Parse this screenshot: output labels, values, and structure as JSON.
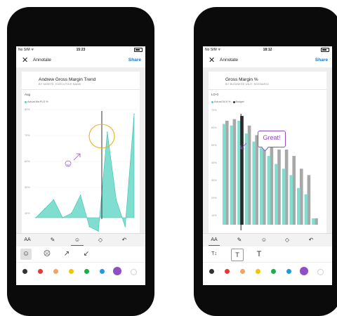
{
  "left_phone": {
    "status": {
      "carrier": "No SIM ᯤ",
      "time": "15:23"
    },
    "header": {
      "title": "Annotate",
      "share_label": "Share"
    },
    "card": {
      "title": "Andrew Gross Margin Trend",
      "subtitle": "BY MONTH, EXECUTIVE NAME",
      "chart_header": "Aug",
      "legend_series": "Actual Ma PLS %",
      "y_ticks": [
        "80%",
        "70%",
        "60%",
        "50%",
        "40%"
      ]
    },
    "toolbar": {
      "text_size": "AA",
      "pen": "✎",
      "stamp": "☺",
      "eraser": "◇",
      "undo": "↶"
    },
    "stamps": {
      "smiley": "☺",
      "neutral": "☹",
      "arrow_up": "↗",
      "arrow_down": "↙"
    },
    "colors": [
      "#333333",
      "#e53935",
      "#f4a261",
      "#f5c400",
      "#1aad4b",
      "#1e9be0",
      "#8f4fc4",
      "#ffffff"
    ]
  },
  "right_phone": {
    "status": {
      "carrier": "No SIM ᯤ",
      "time": "18:12"
    },
    "header": {
      "title": "Annotate",
      "share_label": "Share"
    },
    "card": {
      "title": "Gross Margin %",
      "subtitle": "BY BUSINESS UNIT, SCENARIO",
      "chart_header": "LO-0",
      "legend_actual": "Actual 54.9 %",
      "legend_budget": "Budget",
      "y_ticks": [
        "70%",
        "60%",
        "50%",
        "40%",
        "30%",
        "20%",
        "10%"
      ],
      "callout": "Great!"
    },
    "toolbar": {
      "text_size": "AA",
      "pen": "✎",
      "stamp": "☺",
      "eraser": "◇",
      "undo": "↶"
    },
    "text_tools": [
      "T↕",
      "T",
      "T"
    ],
    "colors": [
      "#333333",
      "#e53935",
      "#f4a261",
      "#f5c400",
      "#1aad4b",
      "#1e9be0",
      "#8f4fc4",
      "#ffffff"
    ]
  },
  "chart_data": [
    {
      "type": "area",
      "title": "Andrew Gross Margin Trend",
      "subtitle": "BY MONTH, EXECUTIVE NAME",
      "series": [
        {
          "name": "Actual Ma PLS %",
          "values": [
            34,
            38,
            42,
            34,
            36,
            44,
            30,
            28,
            72,
            42,
            30,
            80
          ]
        }
      ],
      "ylim": [
        34,
        82
      ],
      "y_ticks": [
        "80%",
        "70%",
        "60%",
        "50%",
        "40%"
      ]
    },
    {
      "type": "bar",
      "title": "Gross Margin %",
      "subtitle": "BY BUSINESS UNIT, SCENARIO",
      "series": [
        {
          "name": "Actual",
          "values": [
            63,
            62,
            65,
            57,
            52,
            48,
            43,
            38,
            35,
            31,
            23,
            19,
            4
          ]
        },
        {
          "name": "Budget",
          "values": [
            65,
            66,
            68,
            62,
            56,
            54,
            50,
            47,
            47,
            43,
            35,
            31,
            4
          ]
        }
      ],
      "ylim": [
        0,
        72
      ],
      "y_ticks": [
        "70%",
        "60%",
        "50%",
        "40%",
        "30%",
        "20%",
        "10%"
      ]
    }
  ]
}
